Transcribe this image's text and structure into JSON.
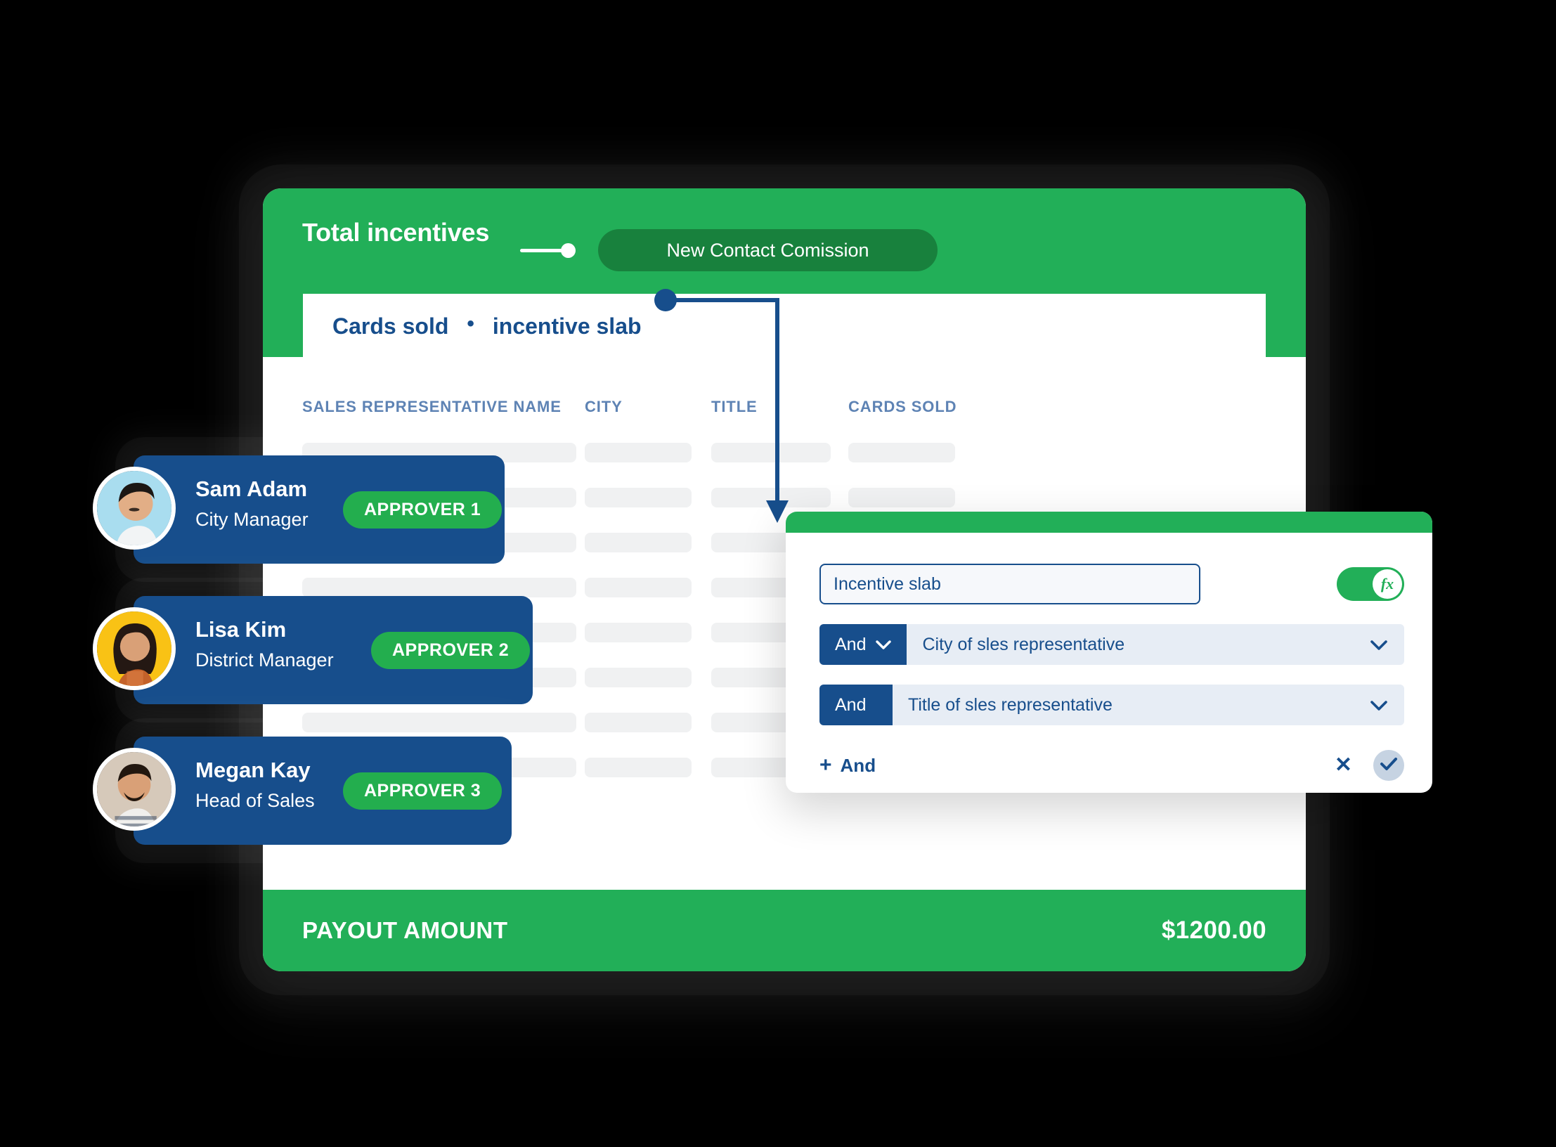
{
  "header": {
    "title": "Total incentives",
    "pill_label": "New  Contact Comission",
    "connector_icon": "line-node-icon"
  },
  "formula_bar": {
    "token_left": "Cards sold",
    "operator": "•",
    "token_right": "incentive slab",
    "node_icon": "connector-dot-icon"
  },
  "table": {
    "columns": [
      "SALES REPRESENTATIVE NAME",
      "CITY",
      "TITLE",
      "CARDS SOLD"
    ],
    "placeholder_row_count": 8
  },
  "payout": {
    "label": "PAYOUT AMOUNT",
    "amount": "$1200.00"
  },
  "approvers": [
    {
      "name": "Sam Adam",
      "role": "City Manager",
      "badge": "APPROVER 1",
      "avatar_icon": "avatar-photo-icon"
    },
    {
      "name": "Lisa Kim",
      "role": "District Manager",
      "badge": "APPROVER 2",
      "avatar_icon": "avatar-photo-icon"
    },
    {
      "name": "Megan Kay",
      "role": "Head of Sales",
      "badge": "APPROVER 3",
      "avatar_icon": "avatar-photo-icon"
    }
  ],
  "rule_popup": {
    "name_value": "Incentive slab",
    "name_placeholder": "Incentive slab",
    "fx_toggle_label": "fx",
    "fx_toggle_state": "on",
    "conditions": [
      {
        "operator": "And",
        "field": "City of sles representative"
      },
      {
        "operator": "And",
        "field": "Title of sles representative"
      }
    ],
    "add_label": "And",
    "add_plus": "+",
    "close_label": "✕",
    "confirm_icon": "check-icon"
  },
  "colors": {
    "green": "#22AF58",
    "dark_green": "#18813D",
    "blue": "#174E8C",
    "badge_green": "#23AE4E",
    "header_text": "#5E83B4",
    "skeleton": "#F0F1F2",
    "field_bg": "#E7EDF5",
    "background": "#000000"
  }
}
